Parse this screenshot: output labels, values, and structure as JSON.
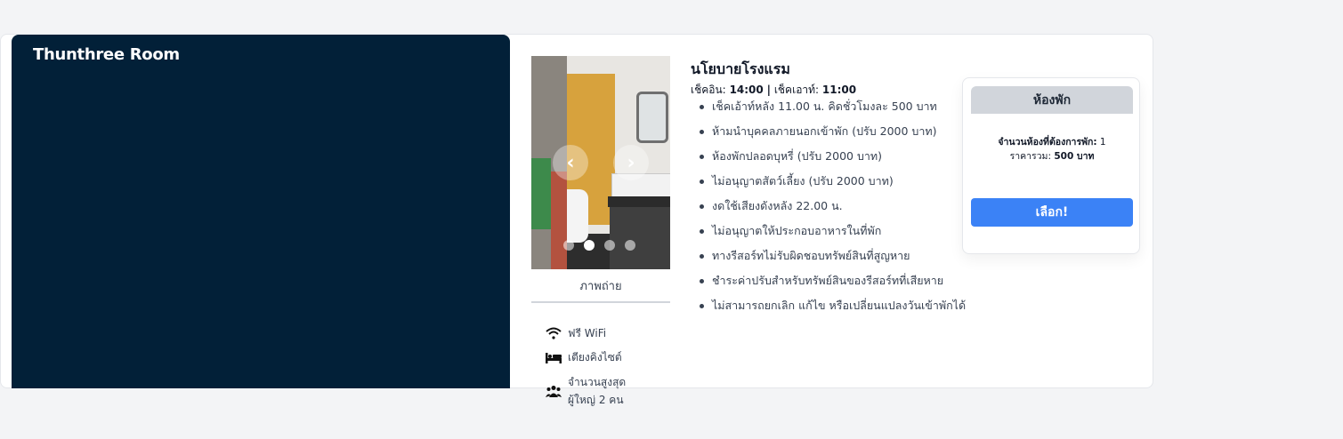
{
  "room": {
    "title": "Thunthree Room"
  },
  "gallery": {
    "prev_icon": "chevron-left-icon",
    "next_icon": "chevron-right-icon",
    "prev_glyph": "‹",
    "next_glyph": "›",
    "dot_count": 4,
    "active_dot_index": 1,
    "photos_label": "ภาพถ่าย"
  },
  "amenities": [
    {
      "icon": "wifi-icon",
      "label": "ฟรี WiFi"
    },
    {
      "icon": "bed-icon",
      "label": "เตียงคิงไซต์"
    },
    {
      "icon": "users-icon",
      "label_line1": "จำนวนสูงสุด",
      "label_line2": "ผู้ใหญ่ 2 คน"
    }
  ],
  "policy": {
    "title": "นโยบายโรงแรม",
    "checkin_label": "เช็คอิน:",
    "checkin_time": "14:00",
    "separator": "|",
    "checkout_label": "เช็คเอาท์:",
    "checkout_time": "11:00",
    "rules": [
      "เช็คเอ้าท์หลัง 11.00 น. คิดชั่วโมงละ 500 บาท",
      "ห้ามนำบุคคลภายนอกเข้าพัก (ปรับ 2000 บาท)",
      "ห้องพักปลอดบุหรี่ (ปรับ 2000 บาท)",
      "ไม่อนุญาตสัตว์เลี้ยง (ปรับ 2000 บาท)",
      "งดใช้เสียงดังหลัง 22.00 น.",
      "ไม่อนุญาตให้ประกอบอาหารในที่พัก",
      "ทางรีสอร์ทไม่รับผิดชอบทรัพย์สินที่สูญหาย",
      "ชำระค่าปรับสำหรับทรัพย์สินของรีสอร์ทที่เสียหาย",
      "ไม่สามารถยกเลิก แก้ไข หรือเปลี่ยนแปลงวันเข้าพักได้"
    ]
  },
  "booking": {
    "header": "ห้องพัก",
    "rooms_label": "จำนวนห้องที่ต้องการพัก:",
    "rooms_value": "1",
    "price_label": "ราคารวม:",
    "price_value": "500 บาท",
    "select_label": "เลือก!",
    "accent_color": "#3b82f6"
  },
  "colors": {
    "left_panel": "#022038",
    "background": "#f3f4f6"
  }
}
